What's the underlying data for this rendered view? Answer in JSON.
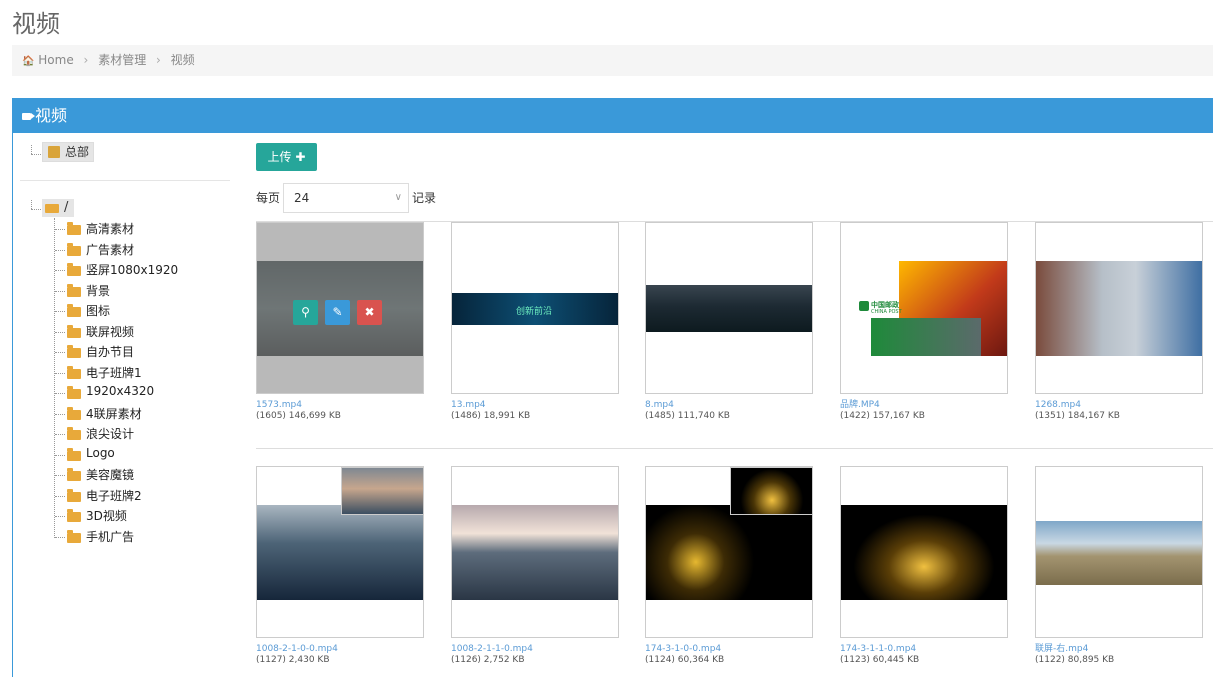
{
  "page_title": "视频",
  "breadcrumb": {
    "home": "Home",
    "level1": "素材管理",
    "level2": "视频"
  },
  "panel_title": "视频",
  "tree": {
    "root": "总部",
    "top_folder": "/",
    "folders": [
      "高清素材",
      "广告素材",
      "竖屏1080x1920",
      "背景",
      "图标",
      "联屏视频",
      "自办节目",
      "电子班牌1",
      "1920x4320",
      "4联屏素材",
      "浪尖设计",
      "Logo",
      "美容魔镜",
      "电子班牌2",
      "3D视频",
      "手机广告"
    ]
  },
  "toolbar": {
    "upload_label": "上传",
    "per_page_label": "每页",
    "per_page_value": "24",
    "records_label": "记录"
  },
  "videos": [
    {
      "name": "1573.mp4",
      "meta": "(1605) 146,699 KB"
    },
    {
      "name": "13.mp4",
      "meta": "(1486) 18,991 KB"
    },
    {
      "name": "8.mp4",
      "meta": "(1485) 111,740 KB"
    },
    {
      "name": "品牌.MP4",
      "meta": "(1422) 157,167 KB"
    },
    {
      "name": "1268.mp4",
      "meta": "(1351) 184,167 KB"
    },
    {
      "name": "1008-2-1-0-0.mp4",
      "meta": "(1127) 2,430 KB"
    },
    {
      "name": "1008-2-1-1-0.mp4",
      "meta": "(1126) 2,752 KB"
    },
    {
      "name": "174-3-1-0-0.mp4",
      "meta": "(1124) 60,364 KB"
    },
    {
      "name": "174-3-1-1-0.mp4",
      "meta": "(1123) 60,445 KB"
    },
    {
      "name": "联屏-右.mp4",
      "meta": "(1122) 80,895 KB"
    }
  ],
  "thumb_text": {
    "video2": "创新前沿",
    "post_brand": "中国邮政",
    "post_sub": "CHINA POST"
  },
  "colors": {
    "accent": "#3a99d9",
    "upload_button": "#26a69a",
    "search_action": "#26a69a",
    "edit_action": "#3a99d9",
    "delete_action": "#d9534f",
    "folder": "#e8a93a",
    "link": "#5b9bd5"
  }
}
